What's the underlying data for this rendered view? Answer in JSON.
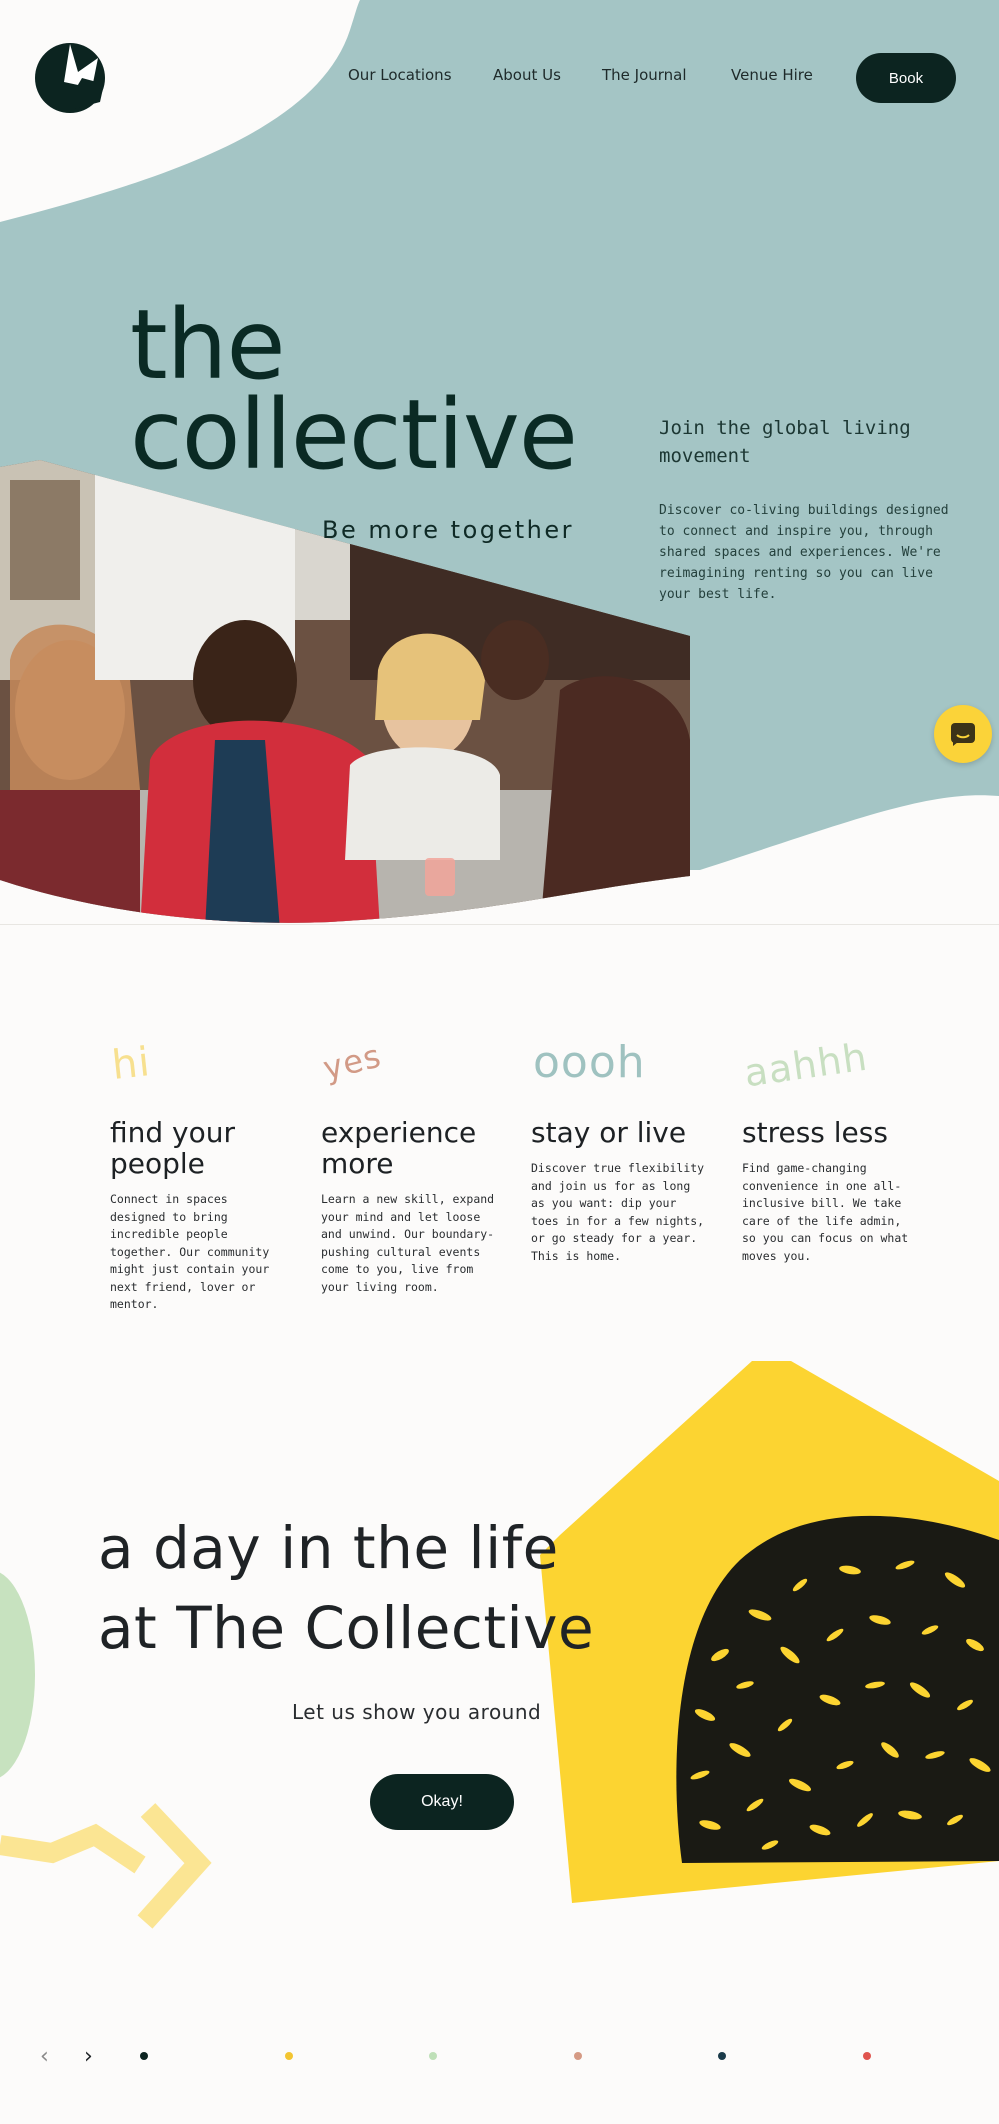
{
  "nav": {
    "logo_icon": "collective-logo-icon",
    "links": [
      "Our Locations",
      "About Us",
      "The Journal",
      "Venue Hire"
    ],
    "book_label": "Book"
  },
  "hero": {
    "title_line1": "the",
    "title_line2": "collective",
    "tagline": "Be more together",
    "sub_heading": "Join the global living movement",
    "description": "Discover co-living buildings designed to connect and inspire you, through shared spaces and experiences. We're reimagining renting so you can live your best life.",
    "chat_icon": "chat-bubble-icon"
  },
  "features": [
    {
      "word": "hi",
      "title_line1": "find your",
      "title_line2": "people",
      "text": "Connect in spaces designed to bring incredible people together. Our community might just contain your next friend, lover or mentor.",
      "color": "#f7e08f"
    },
    {
      "word": "yes",
      "title_line1": "experience",
      "title_line2": "more",
      "text": "Learn a new skill, expand your mind and let loose and unwind. Our boundary-pushing cultural events come to you, live from your living room.",
      "color": "#d29a86"
    },
    {
      "word": "oooh",
      "title_line1": "stay or live",
      "title_line2": "",
      "text": "Discover true flexibility and join us for as long as you want: dip your toes in for a few nights, or go steady for a year. This is home.",
      "color": "#9fc2c0"
    },
    {
      "word": "aahhh",
      "title_line1": "stress less",
      "title_line2": "",
      "text": "Find game-changing convenience in one all-inclusive bill. We take care of the life admin, so you can focus on what moves you.",
      "color": "#c8dfc1"
    }
  ],
  "day": {
    "title_line1": "a day in the life",
    "title_line2": "at The Collective",
    "subtitle": "Let us show you around",
    "button_label": "Okay!"
  },
  "carousel": {
    "prev_icon": "chevron-left-icon",
    "next_icon": "chevron-right-icon",
    "prev_glyph": "‹",
    "next_glyph": "›",
    "dots": [
      "#0c2420",
      "#f3c531",
      "#bfe0b8",
      "#d59a84",
      "#1b3b4a",
      "#e0544e"
    ]
  },
  "colors": {
    "teal": "#a4c5c5",
    "dark": "#0c2420",
    "yellow": "#fcd431",
    "green": "#c7e2bf",
    "pale_yellow": "#fbe593"
  }
}
